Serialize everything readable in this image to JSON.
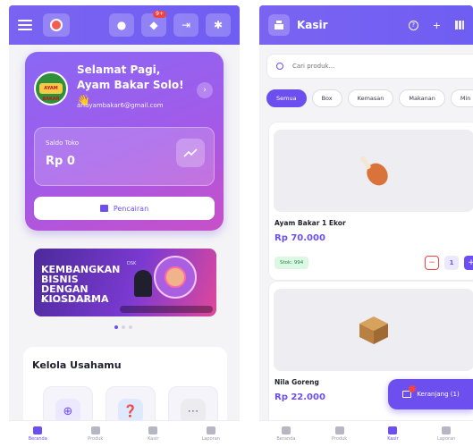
{
  "left": {
    "header": {
      "notification_badge": "9+"
    },
    "profile": {
      "greeting": "Selamat Pagi, Ayam Bakar Solo! 👋",
      "email": "ariayambakar6@gmail.com",
      "avatar_text": "AYAM BAKAR"
    },
    "saldo": {
      "label": "Saldo Toko",
      "value": "Rp 0"
    },
    "pencairan_label": "Pencairan",
    "banner": {
      "headline": "KEMBANGKAN BISNIS DENGAN KIOSDARMA",
      "tag": "DSK",
      "small_text": "Kiat sukses untuk usaha kamu"
    },
    "kelola": {
      "title": "Kelola Usahamu"
    },
    "nav": [
      {
        "label": "Beranda",
        "active": true
      },
      {
        "label": "Produk",
        "active": false
      },
      {
        "label": "Kasir",
        "active": false
      },
      {
        "label": "Laporan",
        "active": false
      }
    ]
  },
  "right": {
    "header": {
      "title": "Kasir"
    },
    "search": {
      "placeholder": "Cari produk..."
    },
    "chips": [
      {
        "label": "Semua",
        "active": true
      },
      {
        "label": "Box",
        "active": false
      },
      {
        "label": "Kemasan",
        "active": false
      },
      {
        "label": "Makanan",
        "active": false
      },
      {
        "label": "Min",
        "active": false
      }
    ],
    "products": [
      {
        "name": "Ayam Bakar 1 Ekor",
        "price": "Rp 70.000",
        "stock": "Stok: 994",
        "qty": "1"
      },
      {
        "name": "Nila Goreng",
        "price": "Rp 22.000"
      }
    ],
    "cart_label": "Keranjang (1)",
    "nav": [
      {
        "label": "Beranda",
        "active": false
      },
      {
        "label": "Produk",
        "active": false
      },
      {
        "label": "Kasir",
        "active": true
      },
      {
        "label": "Laporan",
        "active": false
      }
    ]
  }
}
